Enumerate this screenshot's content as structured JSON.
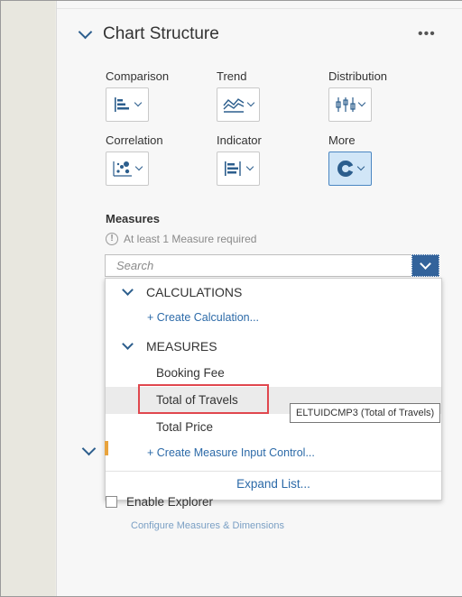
{
  "panel": {
    "section_title": "Chart Structure",
    "more_label": "•••"
  },
  "chart_types": [
    {
      "label": "Comparison",
      "icon": "bar-chart-icon",
      "active": false
    },
    {
      "label": "Trend",
      "icon": "area-chart-icon",
      "active": false
    },
    {
      "label": "Distribution",
      "icon": "box-plot-icon",
      "active": false
    },
    {
      "label": "Correlation",
      "icon": "scatter-chart-icon",
      "active": false
    },
    {
      "label": "Indicator",
      "icon": "indicator-chart-icon",
      "active": false
    },
    {
      "label": "More",
      "icon": "donut-chart-icon",
      "active": true
    }
  ],
  "measures": {
    "title": "Measures",
    "requirement": "At least 1 Measure required",
    "search_placeholder": "Search"
  },
  "dropdown": {
    "calculations_label": "CALCULATIONS",
    "create_calculation": "+ Create Calculation...",
    "measures_label": "MEASURES",
    "items": [
      "Booking Fee",
      "Total of Travels",
      "Total Price"
    ],
    "hovered_item": "Total of Travels",
    "create_measure_input": "+ Create Measure Input Control...",
    "expand_list": "Expand List..."
  },
  "tooltip": "ELTUIDCMP3 (Total of Travels)",
  "explorer": {
    "checkbox_label": "Enable Explorer",
    "checked": false,
    "configure_link": "Configure Measures & Dimensions"
  },
  "colors": {
    "accent": "#33639b",
    "link": "#2c6aa8",
    "highlight": "#e0474e",
    "active_bg": "#d1e6f7"
  }
}
